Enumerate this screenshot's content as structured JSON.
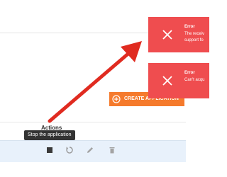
{
  "table": {
    "actions_header": "Actions"
  },
  "row": {
    "actions": [
      "stop-icon",
      "restart-icon",
      "edit-icon",
      "delete-icon"
    ]
  },
  "tooltip": {
    "text": "Stop the application"
  },
  "create_button": {
    "label": "CREATE APPLICATION",
    "icon": "plus-circle-icon"
  },
  "toasts": [
    {
      "title": "Error",
      "message": "The receiv... support fo...",
      "message_lines": [
        "The receiv",
        "support fo"
      ],
      "icon": "close-icon"
    },
    {
      "title": "Error",
      "message": "Can't acqu...",
      "message_lines": [
        "Can't acqu"
      ],
      "icon": "close-icon"
    }
  ],
  "colors": {
    "toast_bg": "#ef4d4f",
    "create_button_bg": "#f57a2c",
    "row_highlight": "#e8f1fb",
    "tooltip_bg": "#333333",
    "annotation_arrow": "#e02b20"
  }
}
